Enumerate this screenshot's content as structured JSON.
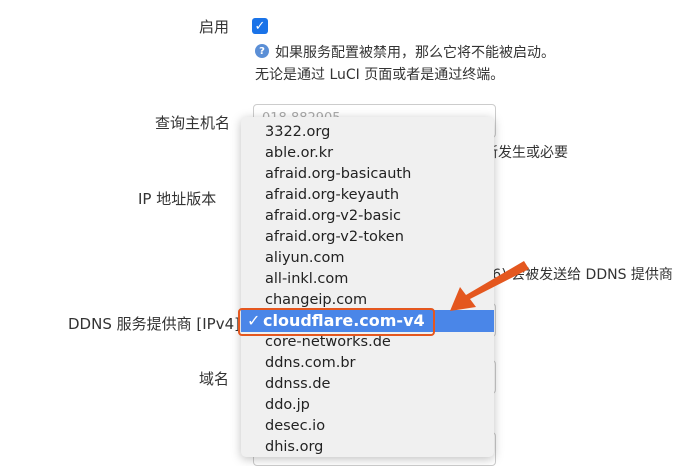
{
  "form": {
    "enable_label": "启用",
    "enable_checked": true,
    "enable_hint_line1": "如果服务配置被禁用，那么它将不能被启动。",
    "enable_hint_line2": "无论是通过 LuCI 页面或者是通过终端。",
    "lookup_host_label": "查询主机名",
    "lookup_host_value": "018 882905 ...",
    "lookup_hint_tail": "新发生或必要",
    "ip_version_label": "IP 地址版本",
    "ip_hint_tail": "v6) 会被发送给 DDNS 提供商",
    "provider_label": "DDNS 服务提供商 [IPv4]",
    "domain_label": "域名"
  },
  "dropdown": {
    "options": [
      "3322.org",
      "able.or.kr",
      "afraid.org-basicauth",
      "afraid.org-keyauth",
      "afraid.org-v2-basic",
      "afraid.org-v2-token",
      "aliyun.com",
      "all-inkl.com",
      "changeip.com",
      "cloudflare.com-v4",
      "core-networks.de",
      "ddns.com.br",
      "ddnss.de",
      "ddo.jp",
      "desec.io",
      "dhis.org"
    ],
    "selected": "cloudflare.com-v4",
    "check_glyph": "✓"
  },
  "colors": {
    "accent": "#1a73e8",
    "selected_bg": "#4a86e8",
    "annotation": "#e4571f"
  }
}
